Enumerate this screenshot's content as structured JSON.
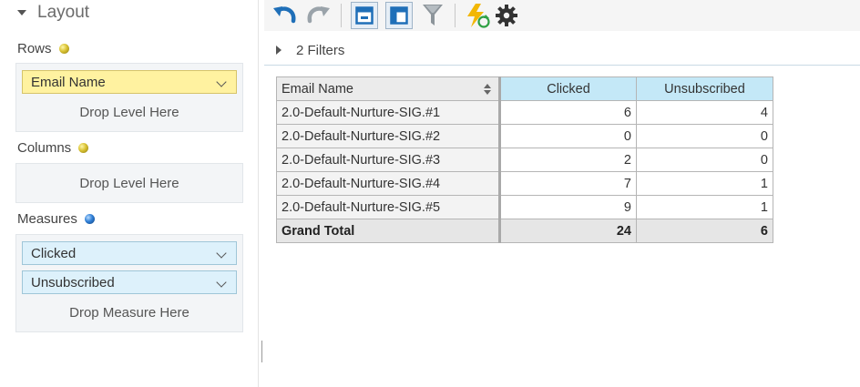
{
  "layout": {
    "title": "Layout",
    "rows_label": "Rows",
    "rows_items": [
      "Email Name"
    ],
    "rows_drop": "Drop Level Here",
    "columns_label": "Columns",
    "columns_drop": "Drop Level Here",
    "measures_label": "Measures",
    "measures_items": [
      "Clicked",
      "Unsubscribed"
    ],
    "measures_drop": "Drop Measure Here"
  },
  "toolbar": {
    "icons": [
      "undo-icon",
      "redo-icon",
      "layout-compact-icon",
      "layout-tabular-icon",
      "filter-icon",
      "refresh-lightning-icon",
      "settings-gear-icon"
    ],
    "colors": {
      "blue": "#1f6fb8",
      "gray": "#9aa3aa",
      "dark": "#333333",
      "yellow": "#f2b705",
      "green": "#2ea043"
    }
  },
  "filters": {
    "label": "2 Filters"
  },
  "pivot": {
    "row_header": "Email Name",
    "columns": [
      "Clicked",
      "Unsubscribed"
    ],
    "rows": [
      {
        "name": "2.0-Default-Nurture-SIG.#1",
        "clicked": "6",
        "unsubscribed": "4"
      },
      {
        "name": "2.0-Default-Nurture-SIG.#2",
        "clicked": "0",
        "unsubscribed": "0"
      },
      {
        "name": "2.0-Default-Nurture-SIG.#3",
        "clicked": "2",
        "unsubscribed": "0"
      },
      {
        "name": "2.0-Default-Nurture-SIG.#4",
        "clicked": "7",
        "unsubscribed": "1"
      },
      {
        "name": "2.0-Default-Nurture-SIG.#5",
        "clicked": "9",
        "unsubscribed": "1"
      }
    ],
    "grand_total": {
      "label": "Grand Total",
      "clicked": "24",
      "unsubscribed": "6"
    }
  }
}
